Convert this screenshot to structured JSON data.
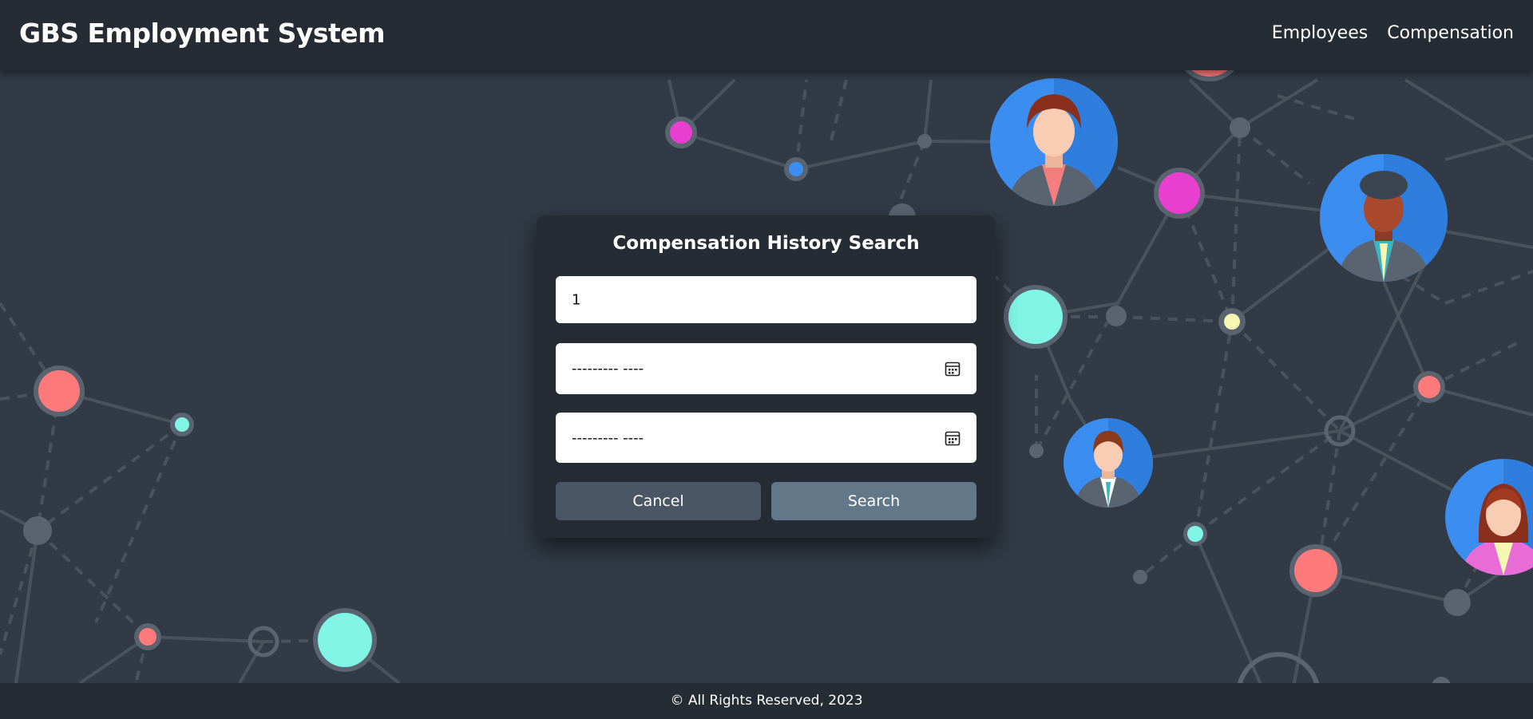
{
  "header": {
    "brand": "GBS Employment System",
    "nav": [
      {
        "label": "Employees"
      },
      {
        "label": "Compensation"
      }
    ]
  },
  "search_form": {
    "title": "Compensation History Search",
    "employee_id_value": "1",
    "start_date_value": "--------- ----",
    "end_date_value": "--------- ----",
    "cancel_label": "Cancel",
    "search_label": "Search"
  },
  "footer": {
    "text": "© All Rights Reserved, 2023"
  },
  "colors": {
    "navbar": "#262c33",
    "background": "#313a45",
    "card": "#262c33",
    "cancel_button": "#4a5664",
    "search_button": "#627888",
    "node_coral": "#ff7a7a",
    "node_cyan": "#80f5e6",
    "node_magenta": "#e83fd0",
    "node_blue": "#3b8ef0",
    "node_yellow": "#f6f7b0"
  },
  "icons": {
    "calendar": "calendar-icon",
    "avatar": "person-avatar-icon"
  }
}
